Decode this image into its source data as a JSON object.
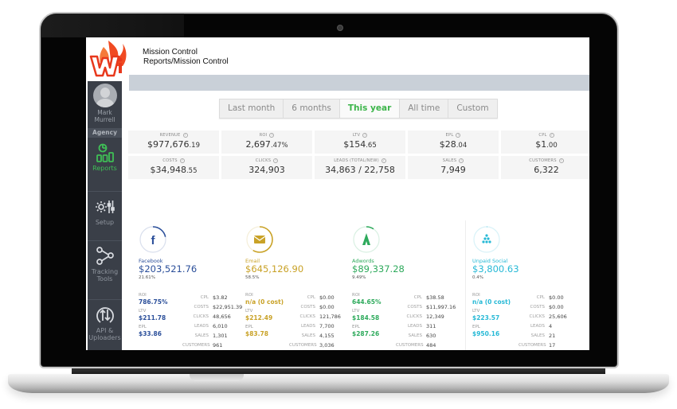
{
  "app": {
    "title": "Mission Control",
    "breadcrumb": "Reports/Mission Control"
  },
  "sidebar": {
    "user_name": "Mark Murrell",
    "role": "Agency",
    "items": [
      {
        "label": "Reports",
        "icon": "reports-chart-icon",
        "active": true
      },
      {
        "label": "Setup",
        "icon": "settings-sliders-icon",
        "active": false
      },
      {
        "label": "Tracking Tools",
        "icon": "share-nodes-icon",
        "active": false
      },
      {
        "label": "API & Uploaders",
        "icon": "upload-download-icon",
        "active": false
      }
    ]
  },
  "range_tabs": [
    {
      "label": "Last month",
      "active": false
    },
    {
      "label": "6 months",
      "active": false
    },
    {
      "label": "This year",
      "active": true
    },
    {
      "label": "All time",
      "active": false
    },
    {
      "label": "Custom",
      "active": false
    }
  ],
  "kpis": [
    {
      "label": "Revenue",
      "value": "$977,676",
      "cents": ".19"
    },
    {
      "label": "ROI",
      "value": "2,697",
      "cents": ".47%"
    },
    {
      "label": "LTV",
      "value": "$154",
      "cents": ".65"
    },
    {
      "label": "EPL",
      "value": "$28",
      "cents": ".04"
    },
    {
      "label": "CPL",
      "value": "$1",
      "cents": ".00"
    },
    {
      "label": "Costs",
      "value": "$34,948",
      "cents": ".55"
    },
    {
      "label": "Clicks",
      "value": "324,903",
      "cents": ""
    },
    {
      "label": "Leads (Total/New)",
      "value": "34,863 / 22,758",
      "cents": ""
    },
    {
      "label": "Sales",
      "value": "7,949",
      "cents": ""
    },
    {
      "label": "Customers",
      "value": "6,322",
      "cents": ""
    }
  ],
  "channels": [
    {
      "name": "Facebook",
      "icon": "facebook-icon",
      "color": "#2b4f9a",
      "revenue": "$203,521.76",
      "share": "21.61%",
      "share_fraction": 0.2161,
      "roi": "786.75%",
      "ltv": "$211.78",
      "epl": "$33.86",
      "left_labels": [
        "ROI",
        "LTV",
        "EPL"
      ],
      "stats": [
        {
          "label": "CPL",
          "value": "$3.82"
        },
        {
          "label": "Costs",
          "value": "$22,951.39"
        },
        {
          "label": "Clicks",
          "value": "48,656"
        },
        {
          "label": "Leads",
          "value": "6,010"
        },
        {
          "label": "Sales",
          "value": "1,301"
        },
        {
          "label": "Customers",
          "value": "961"
        }
      ]
    },
    {
      "name": "Email",
      "icon": "email-envelope-icon",
      "color": "#c9a227",
      "revenue": "$645,126.90",
      "share": "58.5%",
      "share_fraction": 0.585,
      "roi": "n/a (0 cost)",
      "ltv": "$212.49",
      "epl": "$83.78",
      "left_labels": [
        "ROI",
        "LTV",
        "EPL"
      ],
      "stats": [
        {
          "label": "CPL",
          "value": "$0.00"
        },
        {
          "label": "Costs",
          "value": "$0.00"
        },
        {
          "label": "Clicks",
          "value": "121,786"
        },
        {
          "label": "Leads",
          "value": "7,700"
        },
        {
          "label": "Sales",
          "value": "4,155"
        },
        {
          "label": "Customers",
          "value": "3,036"
        }
      ]
    },
    {
      "name": "Adwords",
      "icon": "adwords-icon",
      "color": "#2eaa5c",
      "revenue": "$89,337.28",
      "share": "9.49%",
      "share_fraction": 0.0949,
      "roi": "644.65%",
      "ltv": "$184.58",
      "epl": "$287.26",
      "left_labels": [
        "ROI",
        "LTV",
        "EPL"
      ],
      "stats": [
        {
          "label": "CPL",
          "value": "$38.58"
        },
        {
          "label": "Costs",
          "value": "$11,997.16"
        },
        {
          "label": "Clicks",
          "value": "12,349"
        },
        {
          "label": "Leads",
          "value": "311"
        },
        {
          "label": "Sales",
          "value": "630"
        },
        {
          "label": "Customers",
          "value": "484"
        }
      ]
    },
    {
      "name": "Unpaid Social",
      "icon": "unpaid-social-icon",
      "color": "#27b9d6",
      "revenue": "$3,800.63",
      "share": "0.4%",
      "share_fraction": 0.004,
      "roi": "n/a (0 cost)",
      "ltv": "$223.57",
      "epl": "$950.16",
      "left_labels": [
        "ROI",
        "LTV",
        "EPL"
      ],
      "stats": [
        {
          "label": "CPL",
          "value": "$0.00"
        },
        {
          "label": "Costs",
          "value": "$0.00"
        },
        {
          "label": "Clicks",
          "value": "25,606"
        },
        {
          "label": "Leads",
          "value": "4"
        },
        {
          "label": "Sales",
          "value": "21"
        },
        {
          "label": "Customers",
          "value": "17"
        }
      ]
    }
  ]
}
